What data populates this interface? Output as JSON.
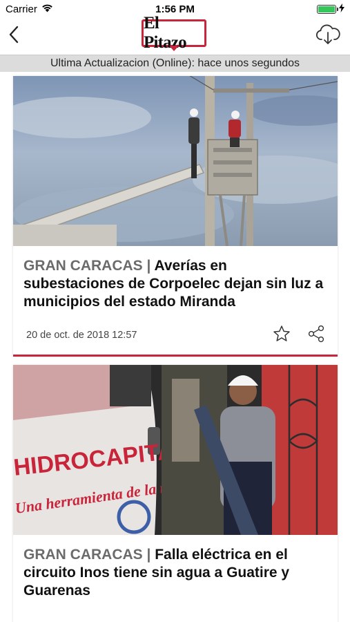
{
  "status_bar": {
    "carrier": "Carrier",
    "time": "1:56 PM",
    "battery_level": 1.0,
    "icons": [
      "wifi-icon",
      "battery-icon",
      "charging-bolt-icon"
    ]
  },
  "nav": {
    "logo_text": "El Pitazo",
    "back_icon": "chevron-left-icon",
    "download_icon": "cloud-download-icon"
  },
  "update_bar": {
    "text": "Ultima Actualizacion (Online): hace unos segundos"
  },
  "articles": [
    {
      "section": "GRAN CARACAS",
      "separator": " | ",
      "title": "Averías en subestaciones de Corpoelec dejan sin luz a municipios del estado Miranda",
      "date": "20 de oct. de 2018 12:57",
      "image_description_icon": "photo-power-line-workers"
    },
    {
      "section": "GRAN CARACAS",
      "separator": " | ",
      "title": "Falla eléctrica en el circuito Inos tiene sin agua a Guatire y Guarenas",
      "date": "",
      "image_text_1": "HIDROCAPITAL",
      "image_text_2": "Una herramienta de la revolución"
    }
  ],
  "colors": {
    "brand_red": "#c8243a",
    "section_gray": "#6b6b6b",
    "update_bar_bg": "#dcdcdc"
  }
}
